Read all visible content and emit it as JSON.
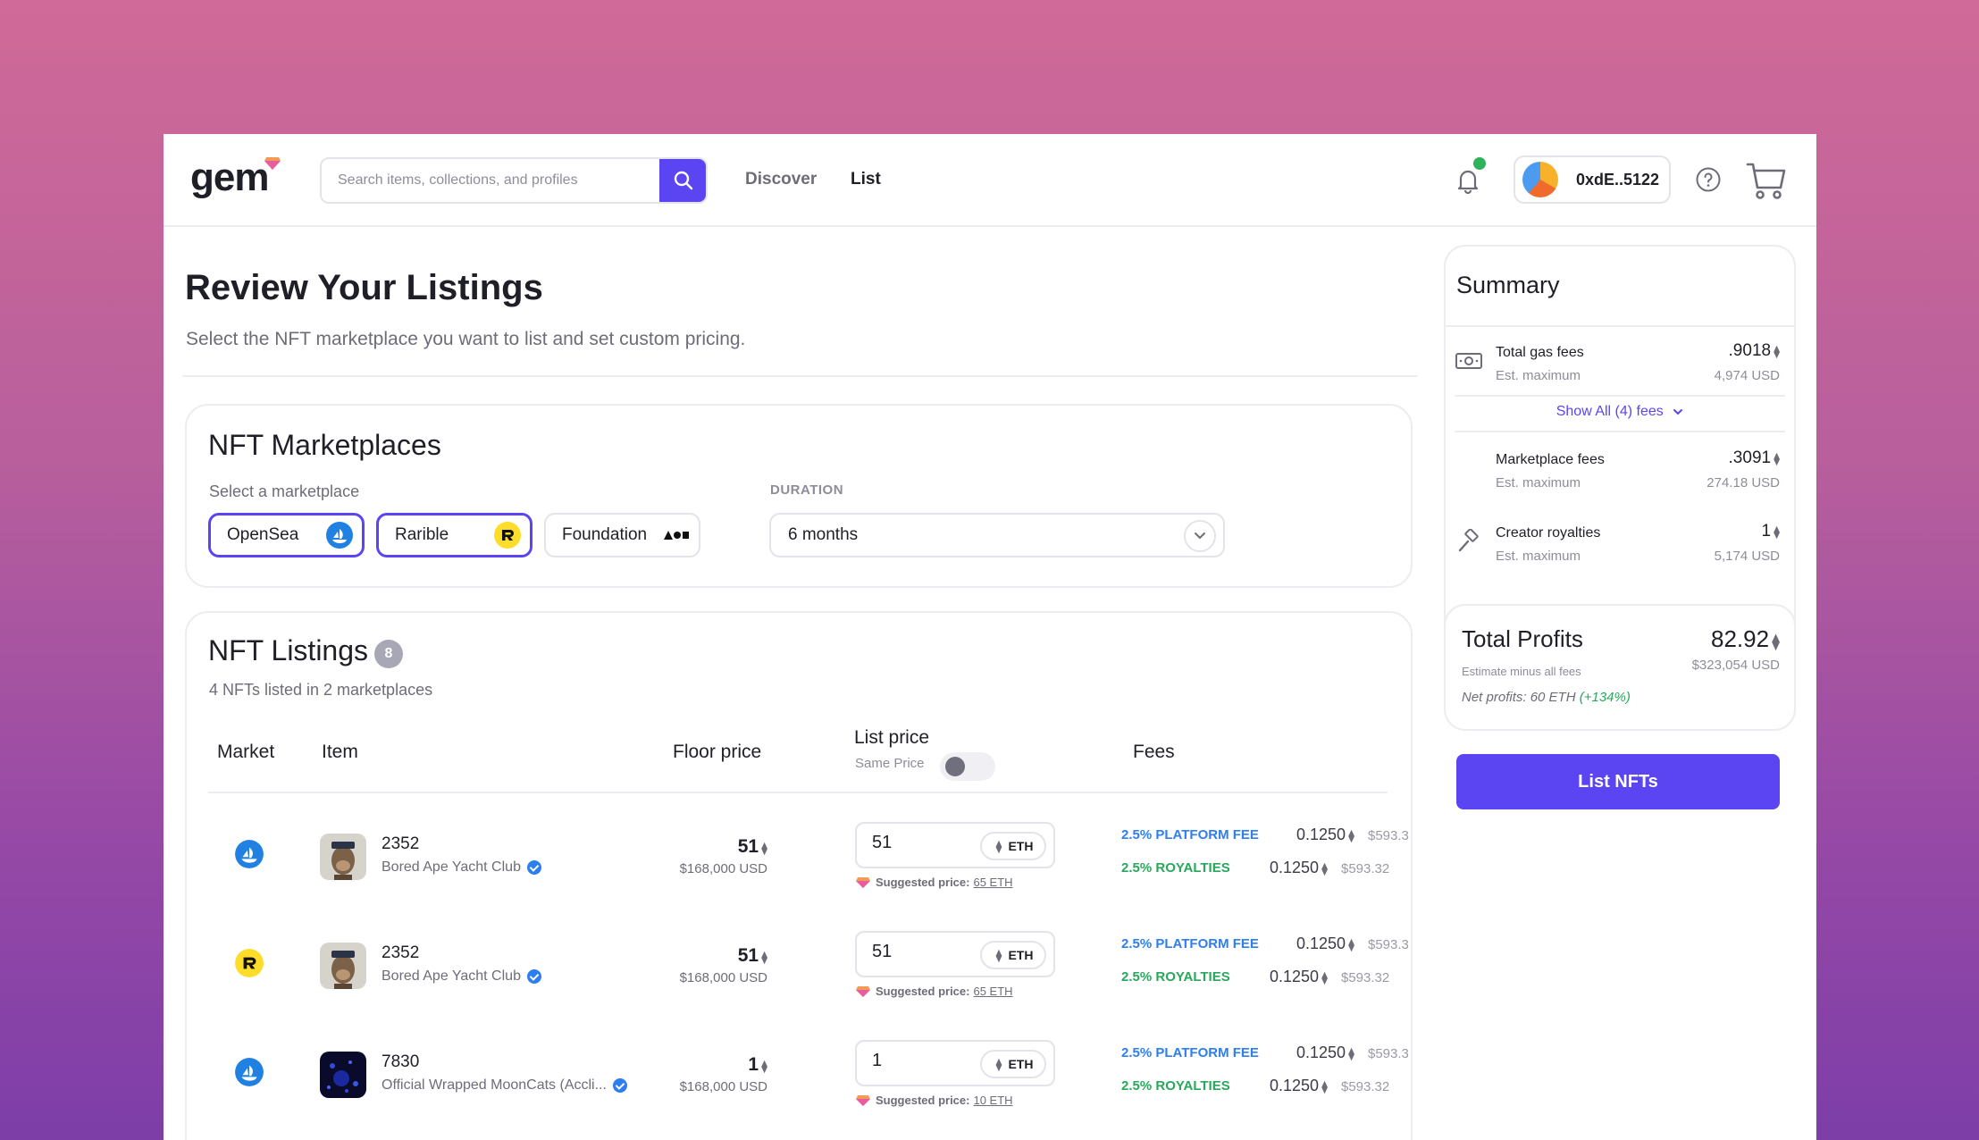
{
  "header": {
    "logo": "gem",
    "search_placeholder": "Search items, collections, and profiles",
    "nav": [
      "Discover",
      "List"
    ],
    "wallet_address": "0xdE..5122"
  },
  "page": {
    "title": "Review Your Listings",
    "subtitle": "Select the NFT marketplace you want to list and set custom pricing."
  },
  "marketplaces": {
    "title": "NFT Marketplaces",
    "select_label": "Select a marketplace",
    "options": [
      {
        "name": "OpenSea",
        "active": true
      },
      {
        "name": "Rarible",
        "active": true
      },
      {
        "name": "Foundation",
        "active": false
      }
    ],
    "duration_label": "DURATION",
    "duration_value": "6 months"
  },
  "listings": {
    "title": "NFT Listings",
    "count": "8",
    "subtitle": "4 NFTs listed in 2 marketplaces",
    "headers": {
      "market": "Market",
      "item": "Item",
      "floor": "Floor price",
      "list": "List price",
      "same_price": "Same Price",
      "fees": "Fees"
    },
    "rows": [
      {
        "market": "opensea",
        "name": "2352",
        "collection": "Bored Ape Yacht Club",
        "floor": "51",
        "floor_usd": "$168,000 USD",
        "price": "51",
        "currency": "ETH",
        "suggested_label": "Suggested price:",
        "suggested": "65 ETH",
        "platform_fee_label": "2.5% PLATFORM FEE",
        "platform_fee": "0.1250",
        "platform_fee_usd": "$593.3",
        "royalty_label": "2.5% ROYALTIES",
        "royalty": "0.1250",
        "royalty_usd": "$593.32"
      },
      {
        "market": "rarible",
        "name": "2352",
        "collection": "Bored Ape Yacht Club",
        "floor": "51",
        "floor_usd": "$168,000 USD",
        "price": "51",
        "currency": "ETH",
        "suggested_label": "Suggested price:",
        "suggested": "65 ETH",
        "platform_fee_label": "2.5% PLATFORM FEE",
        "platform_fee": "0.1250",
        "platform_fee_usd": "$593.3",
        "royalty_label": "2.5% ROYALTIES",
        "royalty": "0.1250",
        "royalty_usd": "$593.32"
      },
      {
        "market": "opensea",
        "name": "7830",
        "collection": "Official Wrapped MoonCats (Accli...",
        "floor": "1",
        "floor_usd": "$168,000 USD",
        "price": "1",
        "currency": "ETH",
        "suggested_label": "Suggested price:",
        "suggested": "10 ETH",
        "platform_fee_label": "2.5% PLATFORM FEE",
        "platform_fee": "0.1250",
        "platform_fee_usd": "$593.3",
        "royalty_label": "2.5% ROYALTIES",
        "royalty": "0.1250",
        "royalty_usd": "$593.32"
      }
    ]
  },
  "summary": {
    "title": "Summary",
    "gas_label": "Total gas fees",
    "gas_sub": "Est. maximum",
    "gas_value": ".9018",
    "gas_usd": "4,974 USD",
    "show_all": "Show All (4) fees",
    "market_label": "Marketplace fees",
    "market_sub": "Est. maximum",
    "market_value": ".3091",
    "market_usd": "274.18 USD",
    "royalty_label": "Creator royalties",
    "royalty_sub": "Est. maximum",
    "royalty_value": "1",
    "royalty_usd": "5,174 USD",
    "profit_title": "Total Profits",
    "profit_sub": "Estimate minus all fees",
    "profit_value": "82.92",
    "profit_usd": "$323,054 USD",
    "net_label": "Net profits: 60 ETH",
    "net_pct": "(+134%)",
    "cta": "List NFTs"
  },
  "colors": {
    "accent": "#5b45f2",
    "platform_fee": "#2d7ef0",
    "royalty": "#27a85b"
  }
}
